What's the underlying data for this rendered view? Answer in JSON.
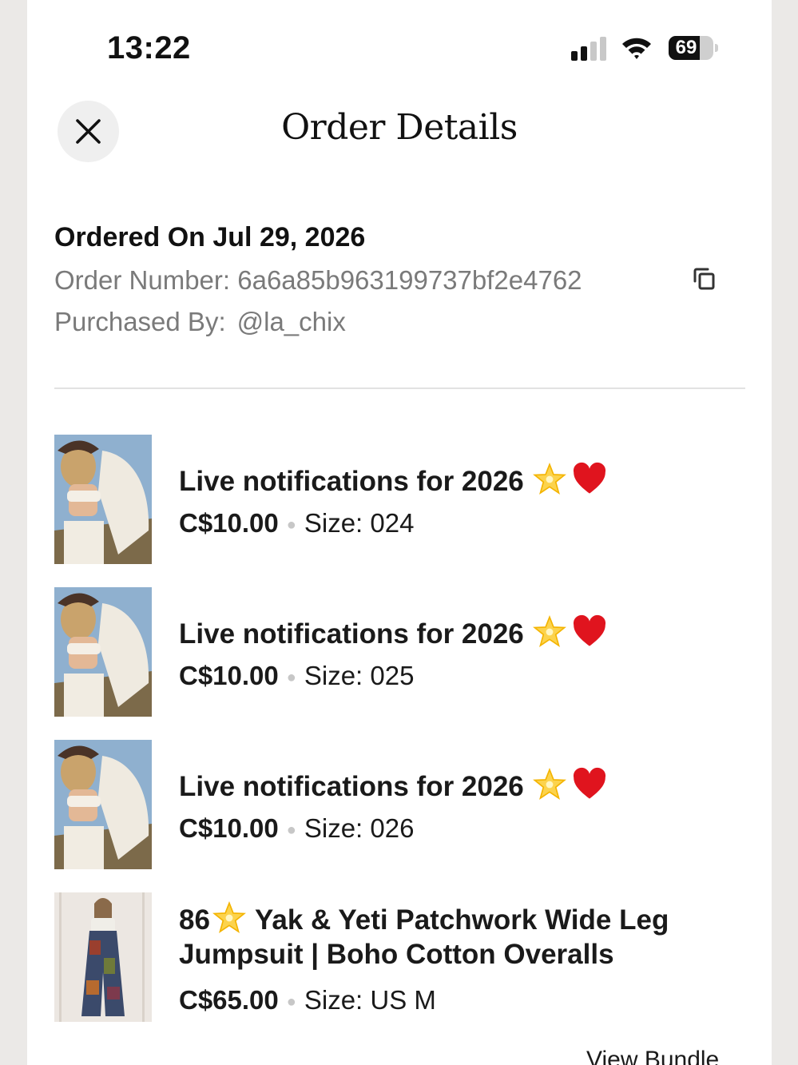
{
  "status_bar": {
    "time": "13:22",
    "battery_level": "69",
    "battery_fraction": 0.69,
    "signal_bars_active": 2,
    "signal_bars_total": 4
  },
  "header": {
    "title": "Order Details",
    "close_icon": "close-icon"
  },
  "order": {
    "date_label": "Ordered On Jul 29, 2026",
    "number_label": "Order Number:",
    "number_value": "6a6a85b963199737bf2e4762",
    "purchased_label": "Purchased By:",
    "purchased_value": "@la_chix",
    "copy_icon": "copy-icon"
  },
  "items": [
    {
      "title_line1": "Live notifications for 2026",
      "title_line2": "",
      "emoji": [
        "glowing-star-icon",
        "red-heart-icon"
      ],
      "price": "C$10.00",
      "size_label": "Size: 024",
      "image": "model-white-outfit"
    },
    {
      "title_line1": "Live notifications for 2026",
      "title_line2": "",
      "emoji": [
        "glowing-star-icon",
        "red-heart-icon"
      ],
      "price": "C$10.00",
      "size_label": "Size: 025",
      "image": "model-white-outfit"
    },
    {
      "title_line1": "Live notifications for 2026",
      "title_line2": "",
      "emoji": [
        "glowing-star-icon",
        "red-heart-icon"
      ],
      "price": "C$10.00",
      "size_label": "Size: 026",
      "image": "model-white-outfit"
    },
    {
      "title_prefix": "86",
      "title_line1": "Yak & Yeti Patchwork Wide Leg",
      "title_line2": "Jumpsuit | Boho Cotton Overalls",
      "emoji": [
        "glowing-star-icon"
      ],
      "price": "C$65.00",
      "size_label": "Size: US M",
      "image": "model-patchwork-jumpsuit"
    }
  ],
  "view_bundle_label": "View Bundle"
}
